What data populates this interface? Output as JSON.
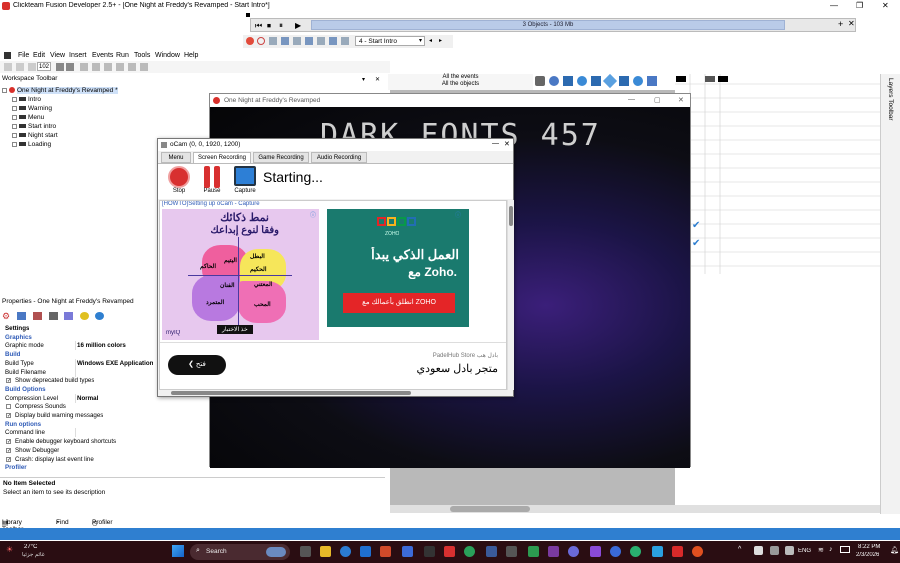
{
  "app": {
    "title": "Clickteam Fusion Developer 2.5+ - [One Night at Freddy's Revamped - Start Intro*]",
    "window_controls": [
      "—",
      "❐",
      "✕"
    ]
  },
  "player": {
    "objects_info": "3 Objects - 103 Mb",
    "frame_select": "4 - Start Intro"
  },
  "menu": [
    "File",
    "Edit",
    "View",
    "Insert",
    "Events",
    "Run",
    "Tools",
    "Window",
    "Help"
  ],
  "toolbar": {
    "zoom": "102"
  },
  "workspace": {
    "title": "Workspace Toolbar",
    "root": "One Night at Freddy's Revamped *",
    "frames": [
      "Intro",
      "Warning",
      "Menu",
      "Start intro",
      "Night start",
      "Loading"
    ]
  },
  "properties": {
    "title": "Properties - One Night at Freddy's Revamped",
    "rows": [
      {
        "type": "header",
        "k": "Settings"
      },
      {
        "type": "sec",
        "k": "Graphics"
      },
      {
        "type": "kv",
        "k": "Graphic mode",
        "v": "16 million colors"
      },
      {
        "type": "sec",
        "k": "Build"
      },
      {
        "type": "kv",
        "k": "Build Type",
        "v": "Windows EXE Application"
      },
      {
        "type": "kv",
        "k": "Build Filename",
        "v": ""
      },
      {
        "type": "chk",
        "k": "Show deprecated build types",
        "c": "✓"
      },
      {
        "type": "sec",
        "k": "Build Options"
      },
      {
        "type": "kv",
        "k": "Compression Level",
        "v": "Normal"
      },
      {
        "type": "chk",
        "k": "Compress Sounds",
        "c": ""
      },
      {
        "type": "chk",
        "k": "Display build warning messages",
        "c": "✓"
      },
      {
        "type": "sec",
        "k": "Run options"
      },
      {
        "type": "kv",
        "k": "Command line",
        "v": ""
      },
      {
        "type": "chk",
        "k": "Enable debugger keyboard shortcuts",
        "c": "✓"
      },
      {
        "type": "chk",
        "k": "Show Debugger",
        "c": "✓"
      },
      {
        "type": "chk",
        "k": "Crash: display last event line",
        "c": "✓"
      },
      {
        "type": "sec",
        "k": "Profiler"
      }
    ],
    "desc_title": "No Item Selected",
    "desc_text": "Select an item to see its description"
  },
  "bottom_tabs": [
    "Library Toolbar",
    "Find",
    "Profiler"
  ],
  "events": {
    "line1": "All the events",
    "line2": "All the objects"
  },
  "layers": {
    "label": "Layers Toolbar"
  },
  "game": {
    "title": "One Night at Freddy's Revamped",
    "text": "DARK FONTS 457"
  },
  "ocam": {
    "title": "oCam (0, 0, 1920, 1200)",
    "tabs": [
      "Menu",
      "Screen Recording",
      "Game Recording",
      "Audio Recording"
    ],
    "tools": [
      "Stop",
      "Pause",
      "Capture"
    ],
    "status": "Starting...",
    "ad": {
      "howto": "[HOWTO]Setting up oCam - Capture",
      "left_title1": "نمط ذكائك",
      "left_title2": "وفقاً لنوع إبداعك",
      "left_btn": "خذ الاختبار",
      "left_brand": "myIQ",
      "petals": [
        "البطل",
        "الحكيم",
        "الحاكم",
        "اليتيم",
        "الفنان",
        "المتمرد",
        "المحب",
        "المعتني"
      ],
      "zoho_logo": "ZOHO",
      "zoho_line1": "العمل الذكي يبدأ",
      "zoho_line2": "مع Zoho.",
      "zoho_btn": "انطلق بأعمالك مع ZOHO",
      "open_btn": "فتح",
      "store_small": "PadelHub Store  بادل هب",
      "store_big": "متجر بادل سعودي"
    }
  },
  "taskbar": {
    "temp": "27°C",
    "weather": "غائم جزئياً",
    "search": "Search",
    "lang": "ENG",
    "time": "8:22 PM",
    "date": "2/3/2026"
  },
  "colors": {
    "accent": "#2f7fd0",
    "taskbar": "#2a0d12",
    "zoho_btn": "#e42527"
  }
}
